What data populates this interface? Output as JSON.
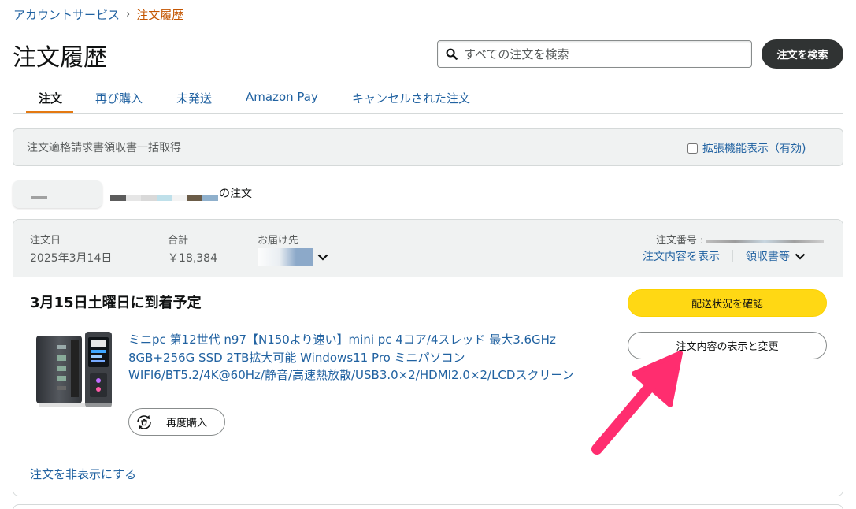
{
  "breadcrumb": {
    "parent": "アカウントサービス",
    "separator": "›",
    "current": "注文履歴"
  },
  "page_title": "注文履歴",
  "search": {
    "placeholder": "すべての注文を検索",
    "button_label": "注文を検索"
  },
  "tabs": [
    {
      "label": "注文",
      "active": true
    },
    {
      "label": "再び購入",
      "active": false
    },
    {
      "label": "未発送",
      "active": false
    },
    {
      "label": "Amazon Pay",
      "active": false
    },
    {
      "label": "キャンセルされた注文",
      "active": false
    }
  ],
  "invoice_bar": {
    "label": "注文適格請求書領収書一括取得",
    "extended_view_label": "拡張機能表示（有効)"
  },
  "order_count_suffix": "の注文",
  "order": {
    "date_label": "注文日",
    "date_value": "2025年3月14日",
    "total_label": "合計",
    "total_value": "￥18,384",
    "ship_to_label": "お届け先",
    "order_number_label": "注文番号 :",
    "view_details_link": "注文内容を表示",
    "receipt_link": "領収書等",
    "delivery_status": "3月15日土曜日に到着予定",
    "product_title": "ミニpc 第12世代 n97【N150より速い】mini pc 4コア/4スレッド 最大3.6GHz 8GB+256G SSD 2TB拡大可能 Windows11 Pro ミニパソコン WIFI6/BT5.2/4K@60Hz/静音/高速熱放散/USB3.0×2/HDMI2.0×2/LCDスクリーン",
    "rebuy_label": "再度購入",
    "track_label": "配送状況を確認",
    "view_edit_label": "注文内容の表示と変更",
    "hide_order_label": "注文を非表示にする"
  },
  "colors": {
    "link": "#2162a1",
    "breadcrumb_current": "#c45500",
    "tab_underline": "#e47911",
    "primary_button": "#ffd814",
    "search_button": "#303333",
    "annotation_arrow": "#ff2d6f"
  },
  "icons": {
    "search": "search-icon",
    "chevron": "chevron-down-icon",
    "rebuy": "rebuy-icon",
    "arrow": "annotation-arrow-icon"
  }
}
